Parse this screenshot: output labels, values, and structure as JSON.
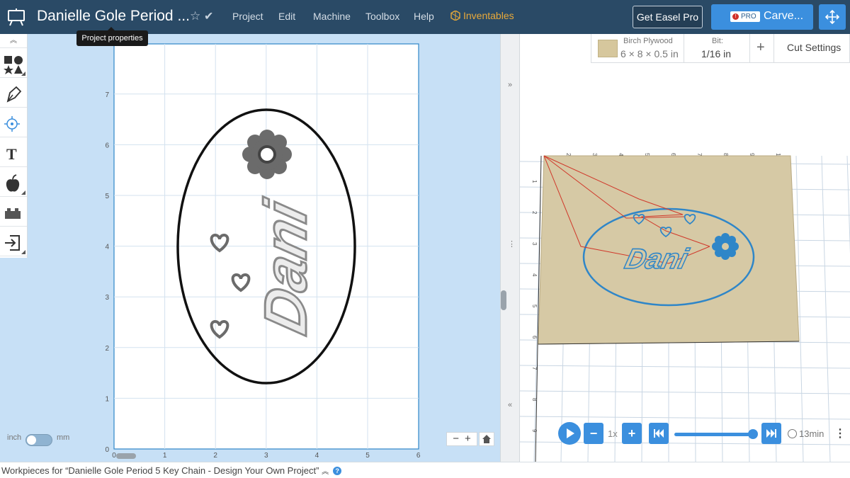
{
  "header": {
    "project_title": "Danielle Gole Period ...",
    "menu": [
      "Project",
      "Edit",
      "Machine",
      "Toolbox",
      "Help"
    ],
    "inventables": "Inventables",
    "get_easel_pro": "Get Easel Pro",
    "pro_badge": "PRO",
    "carve": "Carve..."
  },
  "tooltip": {
    "text": "Project properties"
  },
  "tools": [
    "shapes-tool",
    "pen-tool",
    "target-tool",
    "text-tool",
    "icon-library-tool",
    "apps-tool",
    "import-tool"
  ],
  "canvas": {
    "x_ticks": [
      "0",
      "1",
      "2",
      "3",
      "4",
      "5",
      "6"
    ],
    "y_ticks": [
      "0",
      "1",
      "2",
      "3",
      "4",
      "5",
      "6",
      "7"
    ],
    "design_text": "Dani",
    "units": {
      "inch": "inch",
      "mm": "mm",
      "selected": "inch"
    },
    "zoom_out": "−",
    "zoom_in": "+"
  },
  "material": {
    "name": "Birch Plywood",
    "dims": "6 × 8 × 0.5 in",
    "bit_label": "Bit:",
    "bit_value": "1/16 in",
    "cut_settings": "Cut Settings"
  },
  "preview": {
    "text": "Dani",
    "ruler_top": [
      "2",
      "3",
      "4",
      "5",
      "6",
      "7",
      "8",
      "9",
      "10"
    ],
    "ruler_side": [
      "1",
      "2",
      "3",
      "4",
      "5",
      "6",
      "7",
      "8",
      "9"
    ],
    "speed": "1x",
    "time": "13min",
    "progress": 1.0
  },
  "footer": {
    "workpieces": "Workpieces for “Danielle Gole Period 5 Key Chain - Design Your Own Project”"
  },
  "colors": {
    "topbar": "#2a4a66",
    "accent": "#3b8fde",
    "canvas_bg": "#c7e0f6",
    "toolpath": "#d0392b",
    "cut_outline": "#2f86c8",
    "wood": "#d6c79d"
  }
}
